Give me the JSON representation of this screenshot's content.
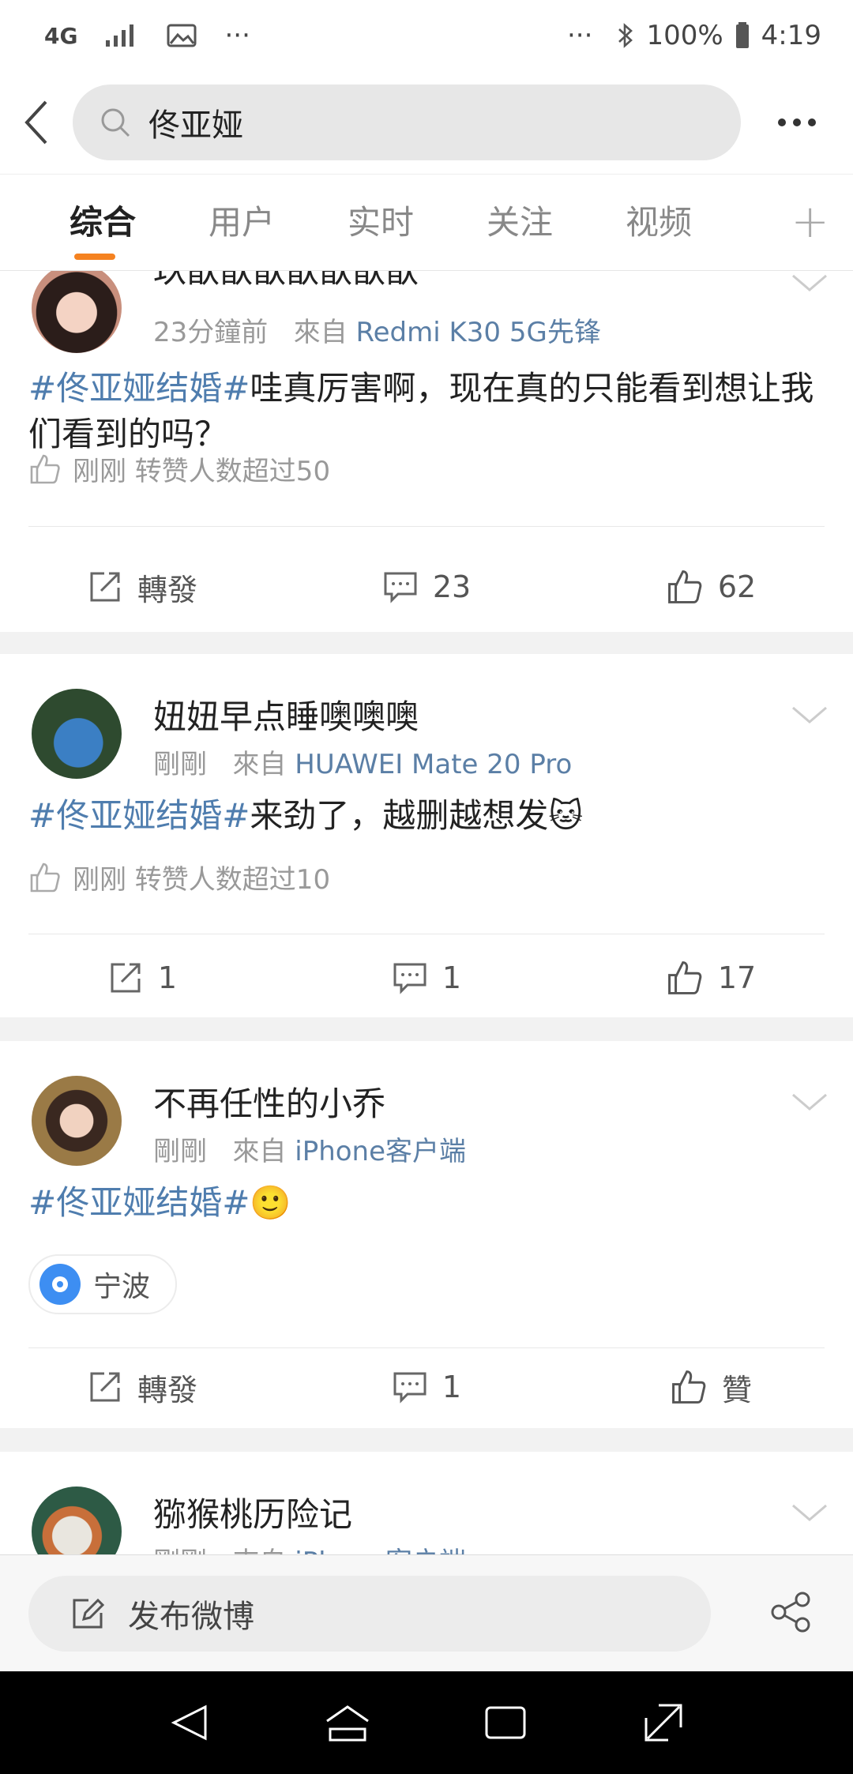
{
  "status_bar": {
    "network": "4G",
    "battery": "100%",
    "time": "4:19",
    "dots": "···"
  },
  "search": {
    "query": "佟亚娅"
  },
  "tabs": [
    {
      "label": "综合",
      "active": true
    },
    {
      "label": "用户",
      "active": false
    },
    {
      "label": "实时",
      "active": false
    },
    {
      "label": "关注",
      "active": false
    },
    {
      "label": "视频",
      "active": false
    }
  ],
  "tab_add": "+",
  "posts": [
    {
      "username": "玖歆歆歆歆歆歆歆",
      "time": "23分鐘前",
      "from_label": "來自",
      "source": "Redmi K30 5G先锋",
      "hashtag": "#佟亚娅结婚#",
      "text": "哇真厉害啊，现在真的只能看到想让我们看到的吗？",
      "like_info": "刚刚 转赞人数超过50",
      "repost": "轉發",
      "comments": "23",
      "likes": "62"
    },
    {
      "username": "妞妞早点睡噢噢噢",
      "time": "剛剛",
      "from_label": "來自",
      "source": "HUAWEI Mate 20 Pro",
      "hashtag": "#佟亚娅结婚#",
      "text": "来劲了，越删越想发",
      "emoji": "🐱",
      "like_info": "刚刚 转赞人数超过10",
      "repost": "1",
      "comments": "1",
      "likes": "17"
    },
    {
      "username": "不再任性的小乔",
      "time": "剛剛",
      "from_label": "來自",
      "source": "iPhone客户端",
      "hashtag": "#佟亚娅结婚#",
      "emoji": "🙂",
      "location": "宁波",
      "repost": "轉發",
      "comments": "1",
      "likes": "贊"
    },
    {
      "username": "猕猴桃历险记",
      "time": "剛剛",
      "from_label": "來自",
      "source": "iPhone客户端"
    }
  ],
  "compose": {
    "label": "发布微博"
  }
}
